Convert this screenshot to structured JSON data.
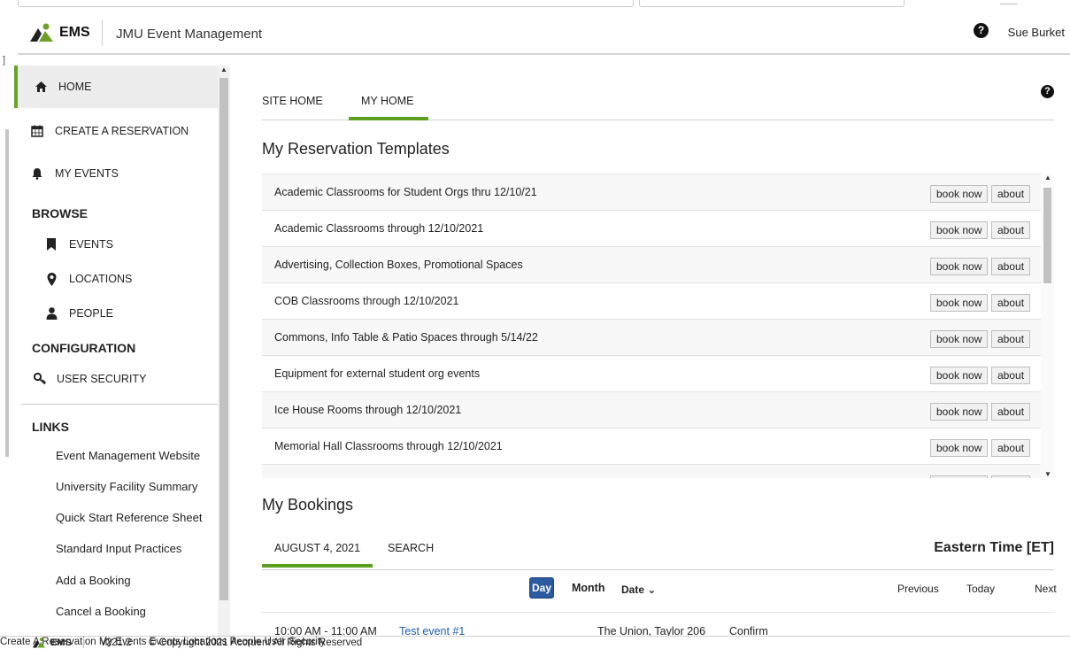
{
  "header": {
    "logo_text": "EMS",
    "app_title": "JMU Event Management",
    "help_glyph": "?",
    "user_name": "Sue Burket"
  },
  "left_edge": {
    "bracket": "]"
  },
  "sidebar": {
    "home": "HOME",
    "create": "CREATE A RESERVATION",
    "my_events": "MY EVENTS",
    "browse_heading": "BROWSE",
    "browse_items": [
      "EVENTS",
      "LOCATIONS",
      "PEOPLE"
    ],
    "config_heading": "CONFIGURATION",
    "user_security": "USER SECURITY",
    "links_heading": "LINKS",
    "links": [
      "Event Management Website",
      "University Facility Summary",
      "Quick Start Reference Sheet",
      "Standard Input Practices",
      "Add a Booking",
      "Cancel a Booking"
    ],
    "icons": {
      "home": "home-icon",
      "create": "calendar-icon",
      "my_events": "bell-icon",
      "events": "bookmark-icon",
      "locations": "map-marker-icon",
      "people": "person-icon",
      "user_security": "key-icon"
    }
  },
  "main": {
    "tabs": [
      "SITE HOME",
      "MY HOME"
    ],
    "active_tab": "MY HOME",
    "templates_title": "My Reservation Templates",
    "book_label": "book now",
    "about_label": "about",
    "templates": [
      "Academic Classrooms for Student Orgs thru 12/10/21",
      "Academic Classrooms through 12/10/2021",
      "Advertising, Collection Boxes, Promotional Spaces",
      "COB Classrooms through 12/10/2021",
      "Commons, Info Table & Patio Spaces through 5/14/22",
      "Equipment for external student org events",
      "Ice House Rooms through 12/10/2021",
      "Memorial Hall Classrooms through 12/10/2021"
    ],
    "bookings_title": "My Bookings",
    "booking_tabs": [
      "AUGUST 4, 2021",
      "SEARCH"
    ],
    "timezone": "Eastern Time [ET]",
    "view_buttons": {
      "day": "Day",
      "month": "Month",
      "date_sort": "Date ⌄"
    },
    "nav_buttons": {
      "previous": "Previous",
      "today": "Today",
      "next": "Next"
    },
    "booking": {
      "time": "10:00 AM - 11:00 AM",
      "title": "Test event #1",
      "location": "The Union, Taylor 206",
      "status": "Confirm"
    }
  },
  "footer": {
    "logo_text": "EMS",
    "version": "v221.2",
    "copyright": "© Copyright 2021 Accruent All Rights Reserved",
    "links": [
      "Create A Reservation",
      "My Events",
      "Events",
      "Locations",
      "People",
      "User Security"
    ]
  },
  "colors": {
    "accent_green": "#5c9e1e",
    "day_button_blue": "#2c5aa0",
    "logo_green": "#6aa128"
  }
}
